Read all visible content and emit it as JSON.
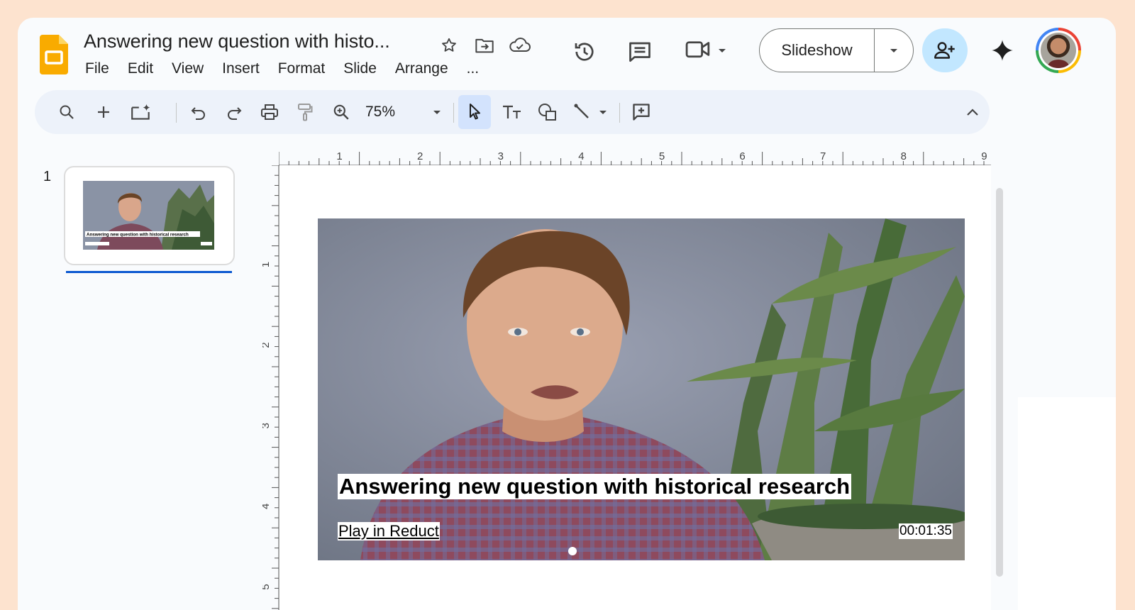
{
  "document": {
    "title": "Answering new question with histo..."
  },
  "menu": [
    "File",
    "Edit",
    "View",
    "Insert",
    "Format",
    "Slide",
    "Arrange",
    "..."
  ],
  "header": {
    "slideshow_label": "Slideshow",
    "icons": [
      "star-icon",
      "move-to-folder-icon",
      "cloud-saved-icon",
      "version-history-icon",
      "comments-icon",
      "meet-camera-icon",
      "share-person-add-icon",
      "gemini-sparkle-icon"
    ]
  },
  "toolbar": {
    "zoom": "75%",
    "icons": [
      "search-icon",
      "new-slide-icon",
      "new-slide-with-layout-icon",
      "undo-icon",
      "redo-icon",
      "print-icon",
      "paint-format-icon",
      "zoom-icon",
      "select-icon",
      "text-box-icon",
      "shape-icon",
      "line-icon",
      "comment-add-icon",
      "collapse-icon"
    ]
  },
  "filmstrip": {
    "slide_number": "1",
    "thumbnail_caption": "Answering new question with historical research"
  },
  "ruler": {
    "horizontal": [
      "1",
      "2",
      "3",
      "4",
      "5",
      "6",
      "7",
      "8",
      "9"
    ],
    "vertical": [
      "1",
      "2",
      "3",
      "4",
      "5"
    ]
  },
  "slide": {
    "caption": "Answering new question with historical research",
    "link_text": "Play in Reduct",
    "timestamp": "00:01:35"
  },
  "colors": {
    "background": "#fde3cf",
    "accent": "#0b57d0",
    "share_button": "#c2e7ff",
    "toolbar": "#edf2fa",
    "logo": "#f9ab00"
  }
}
